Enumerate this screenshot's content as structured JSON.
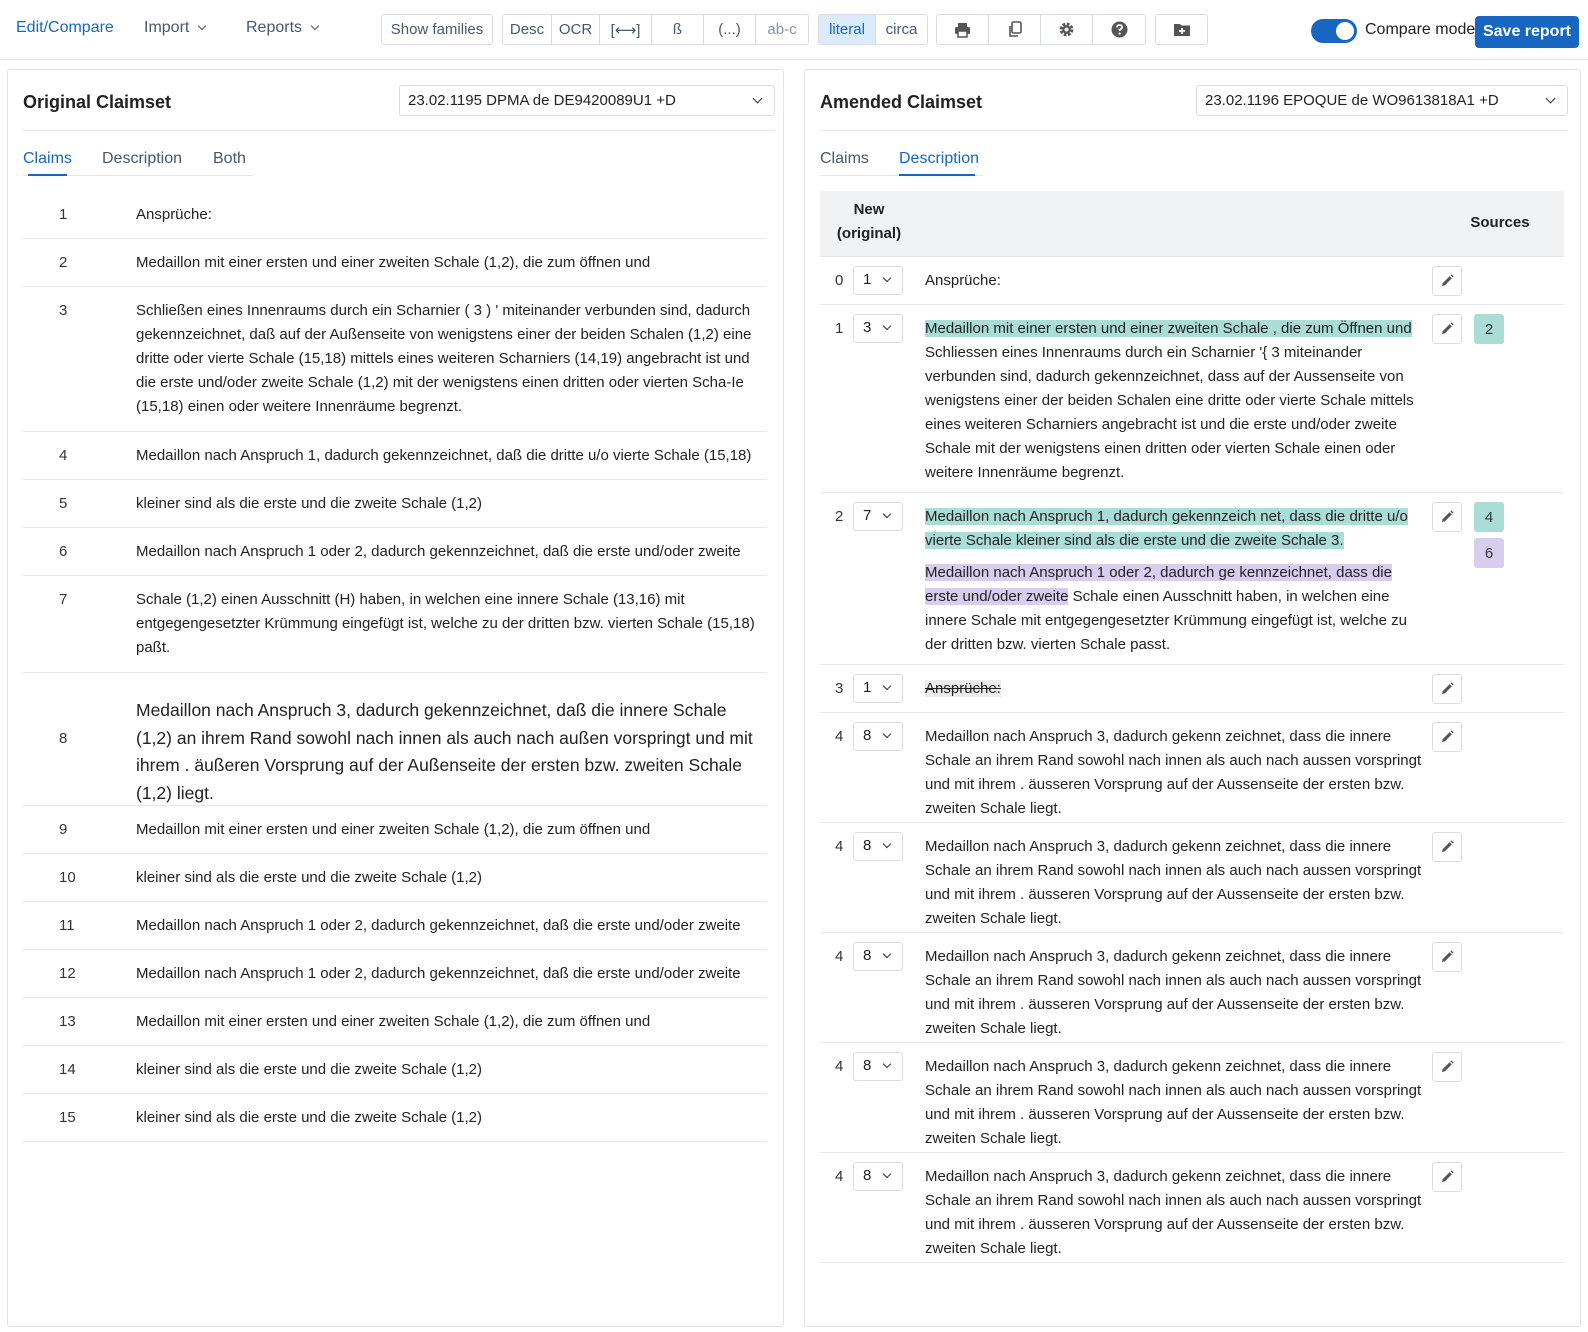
{
  "toolbar": {
    "edit_compare": "Edit/Compare",
    "import": "Import",
    "reports": "Reports",
    "show_families": "Show families",
    "desc": "Desc",
    "ocr": "OCR",
    "bracket_arrows": "[⟷]",
    "eszett": "ß",
    "ellipsis": "(...)",
    "hyphen": "ab-c",
    "literal": "literal",
    "circa": "circa",
    "icons": [
      "print-icon",
      "copy-icon",
      "gear-icon",
      "help-icon",
      "folder-plus-icon"
    ],
    "compare_mode_label": "Compare mode",
    "compare_mode_on": true,
    "save_report": "Save report"
  },
  "left": {
    "title": "Original Claimset",
    "source_select": "23.02.1195 DPMA de DE9420089U1  +D",
    "tabs": [
      "Claims",
      "Description",
      "Both"
    ],
    "active_tab": "Claims",
    "claims": [
      {
        "num": "1",
        "text": "Ansprüche:"
      },
      {
        "num": "2",
        "text": "Medaillon mit einer ersten und einer zweiten Schale (1,2), die zum öffnen und"
      },
      {
        "num": "3",
        "text": "Schließen eines Innenraums durch ein Scharnier ( 3 ) ' miteinander verbunden sind, dadurch gekennzeichnet, daß auf der Außenseite von wenigstens einer der beiden Schalen (1,2) eine dritte oder vierte Schale (15,18) mittels eines weiteren Scharniers (14,19) angebracht ist und die erste und/oder zweite Schale (1,2) mit der wenigstens einen dritten oder vierten Scha-Ie (15,18) einen oder weitere Innenräume begrenzt."
      },
      {
        "num": "4",
        "text": "Medaillon nach Anspruch 1, dadurch gekennzeichnet, daß die dritte u/o vierte Schale (15,18)"
      },
      {
        "num": "5",
        "text": "kleiner sind als die erste und die zweite Schale (1,2)"
      },
      {
        "num": "6",
        "text": "Medaillon nach Anspruch 1 oder 2, dadurch gekennzeichnet, daß die erste und/oder zweite"
      },
      {
        "num": "7",
        "text": "Schale (1,2) einen Ausschnitt (H) haben, in welchen eine innere Schale (13,16) mit entgegengesetzter Krümmung eingefügt ist, welche zu der dritten bzw. vierten Schale (15,18) paßt."
      },
      {
        "num": "8",
        "text": "Medaillon nach Anspruch 3, dadurch gekennzeichnet, daß die innere Schale (1,2) an ihrem Rand sowohl nach innen als auch nach außen vorspringt und mit ihrem . äußeren Vorsprung auf der Außenseite der ersten bzw. zweiten Schale (1,2) liegt."
      },
      {
        "num": "9",
        "text": "Medaillon mit einer ersten und einer zweiten Schale (1,2), die zum öffnen und"
      },
      {
        "num": "10",
        "text": "kleiner sind als die erste und die zweite Schale (1,2)"
      },
      {
        "num": "11",
        "text": "Medaillon nach Anspruch 1 oder 2, dadurch gekennzeichnet, daß die erste und/oder zweite"
      },
      {
        "num": "12",
        "text": "Medaillon nach Anspruch 1 oder 2, dadurch gekennzeichnet, daß die erste und/oder zweite"
      },
      {
        "num": "13",
        "text": "Medaillon mit einer ersten und einer zweiten Schale (1,2), die zum öffnen und"
      },
      {
        "num": "14",
        "text": "kleiner sind als die erste und die zweite Schale (1,2)"
      },
      {
        "num": "15",
        "text": "kleiner sind als die erste und die zweite Schale (1,2)"
      }
    ]
  },
  "right": {
    "title": "Amended Claimset",
    "source_select": "23.02.1196 EPOQUE de WO9613818A1  +D",
    "tabs": [
      "Claims",
      "Description"
    ],
    "active_tab": "Description",
    "header": {
      "new_original_1": "New",
      "new_original_2": "(original)",
      "sources": "Sources"
    },
    "rows": [
      {
        "idx": "0",
        "sel": "1",
        "text": "Ansprüche:",
        "sources": []
      },
      {
        "idx": "1",
        "sel": "3",
        "text_highlight": "Medaillon mit einer ersten und einer zweiten Schale ,  die zum Öffnen und",
        "text_rest": " Schliessen eines Innenraums durch ein Scharnier  '{ 3 miteinander verbunden sind,  dadurch gekennzeichnet,  dass auf der Aussenseite von wenigstens einer der beiden Schalen  eine dritte oder vierte Schale  mittels eines weiteren Scharniers  angebracht ist und die erste und/oder zweite Schale  mit der wenigstens einen dritten oder vierten Schale  einen oder weitere Innenräume begrenzt.",
        "sources": [
          "2"
        ]
      },
      {
        "idx": "2",
        "sel": "7",
        "text_highlight": "Medaillon nach Anspruch 1,  dadurch gekennzeich net,  dass die dritte u/o vierte Schale  kleiner sind als die erste und die zweite Schale  3. ",
        "text_highlight2": "Medaillon nach Anspruch 1 oder 2,  dadurch ge kennzeichnet,  dass die erste und/oder zweite",
        "text_rest": " Schale  einen Ausschnitt  haben,  in welchen eine innere Schale  mit entgegengesetzter Krümmung eingefügt ist,  welche zu der dritten bzw. vierten Schale  passt.",
        "sources": [
          "4",
          "6"
        ]
      },
      {
        "idx": "3",
        "sel": "1",
        "text_struck": "Ansprüche:",
        "sources": []
      },
      {
        "idx": "4",
        "sel": "8",
        "text": "Medaillon nach Anspruch 3,  dadurch gekenn zeichnet,  dass die innere Schale  an ihrem Rand sowohl nach innen als auch nach aussen vorspringt und mit ihrem . äusseren Vorsprung auf der Aussenseite der ersten bzw. zweiten Schale  liegt.",
        "sources": []
      },
      {
        "idx": "4",
        "sel": "8",
        "text": "Medaillon nach Anspruch 3,  dadurch gekenn zeichnet,  dass die innere Schale  an ihrem Rand sowohl nach innen als auch nach aussen vorspringt und mit ihrem . äusseren Vorsprung auf der Aussenseite der ersten bzw. zweiten Schale  liegt.",
        "sources": []
      },
      {
        "idx": "4",
        "sel": "8",
        "text": "Medaillon nach Anspruch 3,  dadurch gekenn zeichnet,  dass die innere Schale  an ihrem Rand sowohl nach innen als auch nach aussen vorspringt und mit ihrem . äusseren Vorsprung auf der Aussenseite der ersten bzw. zweiten Schale  liegt.",
        "sources": []
      },
      {
        "idx": "4",
        "sel": "8",
        "text": "Medaillon nach Anspruch 3,  dadurch gekenn zeichnet,  dass die innere Schale  an ihrem Rand sowohl nach innen als auch nach aussen vorspringt und mit ihrem . äusseren Vorsprung auf der Aussenseite der ersten bzw. zweiten Schale  liegt.",
        "sources": []
      },
      {
        "idx": "4",
        "sel": "8",
        "text": "Medaillon nach Anspruch 3,  dadurch gekenn zeichnet,  dass die innere Schale  an ihrem Rand sowohl nach innen als auch nach aussen vorspringt und mit ihrem . äusseren Vorsprung auf der Aussenseite der ersten bzw. zweiten Schale  liegt.",
        "sources": []
      }
    ]
  },
  "colors": {
    "accent": "#1766c2",
    "highlight_green": "#a9ddd6",
    "highlight_purple": "#d6cdef"
  }
}
